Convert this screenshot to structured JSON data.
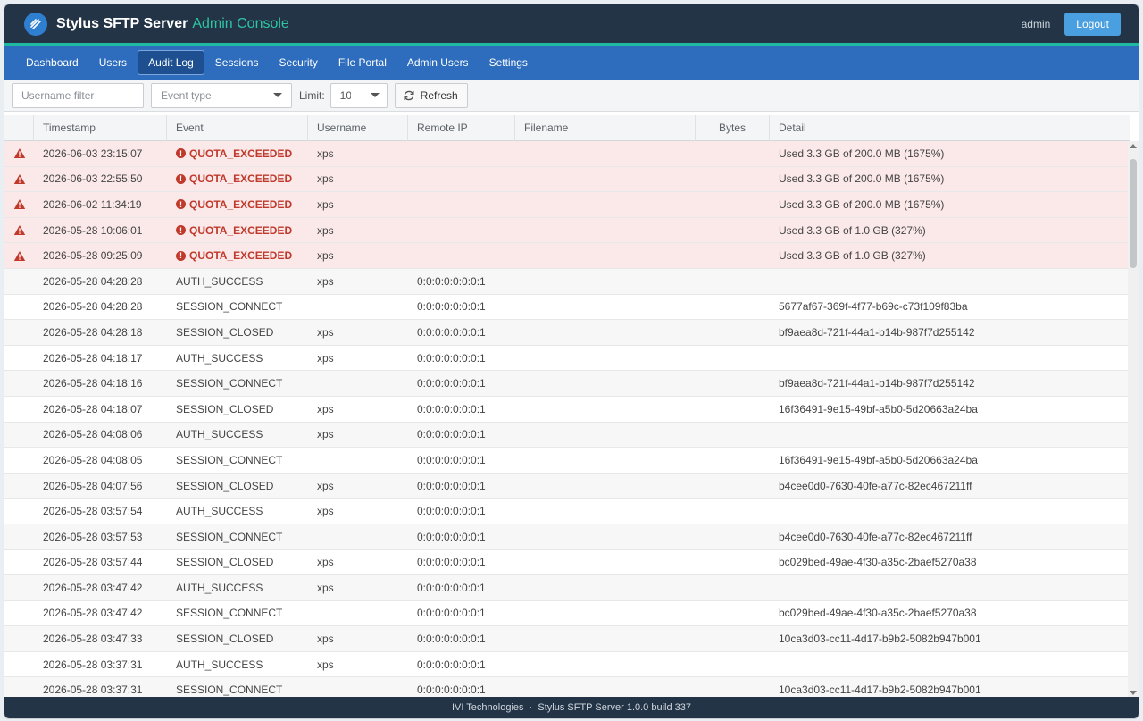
{
  "header": {
    "app_name": "Stylus SFTP Server",
    "app_sub": "Admin Console",
    "user": "admin",
    "logout_label": "Logout"
  },
  "nav": {
    "items": [
      "Dashboard",
      "Users",
      "Audit Log",
      "Sessions",
      "Security",
      "File Portal",
      "Admin Users",
      "Settings"
    ],
    "active": "Audit Log"
  },
  "filters": {
    "username_placeholder": "Username filter",
    "event_type_placeholder": "Event type",
    "limit_label": "Limit:",
    "limit_value": "10",
    "refresh_label": "Refresh"
  },
  "table": {
    "columns": [
      "Timestamp",
      "Event",
      "Username",
      "Remote IP",
      "Filename",
      "Bytes",
      "Detail"
    ],
    "rows": [
      {
        "timestamp": "2026-06-03 23:15:07",
        "event": "QUOTA_EXCEEDED",
        "username": "xps",
        "remote_ip": "",
        "filename": "",
        "bytes": "",
        "detail": "Used 3.3 GB of 200.0 MB (1675%)",
        "alert": true
      },
      {
        "timestamp": "2026-06-03 22:55:50",
        "event": "QUOTA_EXCEEDED",
        "username": "xps",
        "remote_ip": "",
        "filename": "",
        "bytes": "",
        "detail": "Used 3.3 GB of 200.0 MB (1675%)",
        "alert": true
      },
      {
        "timestamp": "2026-06-02 11:34:19",
        "event": "QUOTA_EXCEEDED",
        "username": "xps",
        "remote_ip": "",
        "filename": "",
        "bytes": "",
        "detail": "Used 3.3 GB of 200.0 MB (1675%)",
        "alert": true
      },
      {
        "timestamp": "2026-05-28 10:06:01",
        "event": "QUOTA_EXCEEDED",
        "username": "xps",
        "remote_ip": "",
        "filename": "",
        "bytes": "",
        "detail": "Used 3.3 GB of 1.0 GB (327%)",
        "alert": true
      },
      {
        "timestamp": "2026-05-28 09:25:09",
        "event": "QUOTA_EXCEEDED",
        "username": "xps",
        "remote_ip": "",
        "filename": "",
        "bytes": "",
        "detail": "Used 3.3 GB of 1.0 GB (327%)",
        "alert": true
      },
      {
        "timestamp": "2026-05-28 04:28:28",
        "event": "AUTH_SUCCESS",
        "username": "xps",
        "remote_ip": "0:0:0:0:0:0:0:1",
        "filename": "",
        "bytes": "",
        "detail": "",
        "alert": false
      },
      {
        "timestamp": "2026-05-28 04:28:28",
        "event": "SESSION_CONNECT",
        "username": "",
        "remote_ip": "0:0:0:0:0:0:0:1",
        "filename": "",
        "bytes": "",
        "detail": "5677af67-369f-4f77-b69c-c73f109f83ba",
        "alert": false
      },
      {
        "timestamp": "2026-05-28 04:28:18",
        "event": "SESSION_CLOSED",
        "username": "xps",
        "remote_ip": "0:0:0:0:0:0:0:1",
        "filename": "",
        "bytes": "",
        "detail": "bf9aea8d-721f-44a1-b14b-987f7d255142",
        "alert": false
      },
      {
        "timestamp": "2026-05-28 04:18:17",
        "event": "AUTH_SUCCESS",
        "username": "xps",
        "remote_ip": "0:0:0:0:0:0:0:1",
        "filename": "",
        "bytes": "",
        "detail": "",
        "alert": false
      },
      {
        "timestamp": "2026-05-28 04:18:16",
        "event": "SESSION_CONNECT",
        "username": "",
        "remote_ip": "0:0:0:0:0:0:0:1",
        "filename": "",
        "bytes": "",
        "detail": "bf9aea8d-721f-44a1-b14b-987f7d255142",
        "alert": false
      },
      {
        "timestamp": "2026-05-28 04:18:07",
        "event": "SESSION_CLOSED",
        "username": "xps",
        "remote_ip": "0:0:0:0:0:0:0:1",
        "filename": "",
        "bytes": "",
        "detail": "16f36491-9e15-49bf-a5b0-5d20663a24ba",
        "alert": false
      },
      {
        "timestamp": "2026-05-28 04:08:06",
        "event": "AUTH_SUCCESS",
        "username": "xps",
        "remote_ip": "0:0:0:0:0:0:0:1",
        "filename": "",
        "bytes": "",
        "detail": "",
        "alert": false
      },
      {
        "timestamp": "2026-05-28 04:08:05",
        "event": "SESSION_CONNECT",
        "username": "",
        "remote_ip": "0:0:0:0:0:0:0:1",
        "filename": "",
        "bytes": "",
        "detail": "16f36491-9e15-49bf-a5b0-5d20663a24ba",
        "alert": false
      },
      {
        "timestamp": "2026-05-28 04:07:56",
        "event": "SESSION_CLOSED",
        "username": "xps",
        "remote_ip": "0:0:0:0:0:0:0:1",
        "filename": "",
        "bytes": "",
        "detail": "b4cee0d0-7630-40fe-a77c-82ec467211ff",
        "alert": false
      },
      {
        "timestamp": "2026-05-28 03:57:54",
        "event": "AUTH_SUCCESS",
        "username": "xps",
        "remote_ip": "0:0:0:0:0:0:0:1",
        "filename": "",
        "bytes": "",
        "detail": "",
        "alert": false
      },
      {
        "timestamp": "2026-05-28 03:57:53",
        "event": "SESSION_CONNECT",
        "username": "",
        "remote_ip": "0:0:0:0:0:0:0:1",
        "filename": "",
        "bytes": "",
        "detail": "b4cee0d0-7630-40fe-a77c-82ec467211ff",
        "alert": false
      },
      {
        "timestamp": "2026-05-28 03:57:44",
        "event": "SESSION_CLOSED",
        "username": "xps",
        "remote_ip": "0:0:0:0:0:0:0:1",
        "filename": "",
        "bytes": "",
        "detail": "bc029bed-49ae-4f30-a35c-2baef5270a38",
        "alert": false
      },
      {
        "timestamp": "2026-05-28 03:47:42",
        "event": "AUTH_SUCCESS",
        "username": "xps",
        "remote_ip": "0:0:0:0:0:0:0:1",
        "filename": "",
        "bytes": "",
        "detail": "",
        "alert": false
      },
      {
        "timestamp": "2026-05-28 03:47:42",
        "event": "SESSION_CONNECT",
        "username": "",
        "remote_ip": "0:0:0:0:0:0:0:1",
        "filename": "",
        "bytes": "",
        "detail": "bc029bed-49ae-4f30-a35c-2baef5270a38",
        "alert": false
      },
      {
        "timestamp": "2026-05-28 03:47:33",
        "event": "SESSION_CLOSED",
        "username": "xps",
        "remote_ip": "0:0:0:0:0:0:0:1",
        "filename": "",
        "bytes": "",
        "detail": "10ca3d03-cc11-4d17-b9b2-5082b947b001",
        "alert": false
      },
      {
        "timestamp": "2026-05-28 03:37:31",
        "event": "AUTH_SUCCESS",
        "username": "xps",
        "remote_ip": "0:0:0:0:0:0:0:1",
        "filename": "",
        "bytes": "",
        "detail": "",
        "alert": false
      },
      {
        "timestamp": "2026-05-28 03:37:31",
        "event": "SESSION_CONNECT",
        "username": "",
        "remote_ip": "0:0:0:0:0:0:0:1",
        "filename": "",
        "bytes": "",
        "detail": "10ca3d03-cc11-4d17-b9b2-5082b947b001",
        "alert": false
      }
    ]
  },
  "footer": {
    "text": "IVI Technologies  ·  Stylus SFTP Server 1.0.0 build 337"
  },
  "colors": {
    "header_bg": "#243447",
    "accent": "#2ec4a4",
    "nav_bg": "#2e6dbd",
    "alert_row": "#fbe9ea",
    "alert_text": "#c0392b"
  },
  "icons": {
    "logo": "stylus-logo-icon",
    "refresh": "refresh-icon",
    "warning": "warning-triangle-icon",
    "error": "exclamation-circle-icon",
    "caret": "chevron-down-icon"
  }
}
